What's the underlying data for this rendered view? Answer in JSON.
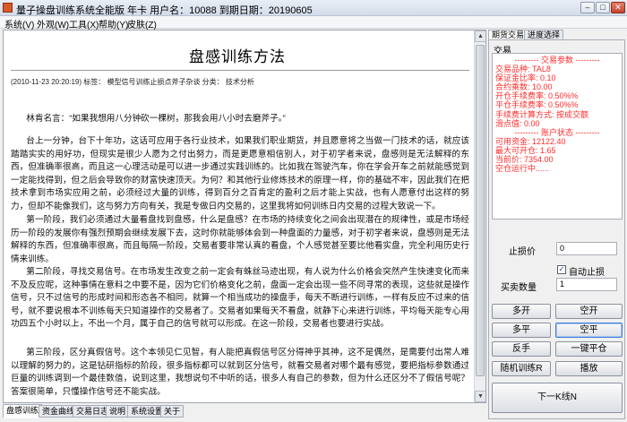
{
  "window": {
    "title": "量子操盘训练系统全能版 年卡 用户名：10088 到期日期：20190605"
  },
  "menu": [
    "系统(V)",
    "外观(W)",
    "工具(X)",
    "帮助(Y)",
    "皮肤(Z)"
  ],
  "doc": {
    "title": "盘感训练方法",
    "meta": "(2010-11-23 20:20:19) 标签：   模型信号训练止损点斧子杂谈  分类：   技术分析",
    "quote": "林肯名言：“如果我想用八分钟砍一棵树，那我会用八小时去磨斧子。”",
    "paragraphs": [
      "台上一分钟，台下十年功，这话可应用于各行业技术，如果我们职业期货，并且愿意将之当做一门技术的话，就应该踏踏实实的用好功，但现实是很少人愿为之付出努力，而是更愿意相信别人，对于初学者来说，盘感则是无法解释的东西，但准确率很高，而且这一心理活动是可以进一步通过实践训练的。比如我在驾驶汽车，你在学会开车之前就能感觉到一定能找得到，但之后会导致你的财富快速顶天。为何？和其他行业修炼技术的原理一样，你的基础不牢，因此我们在把技术拿到市场实应用之前，必须经过大量的训练，得到百分之百肯定的盈利之后才能上实战，也有人愿意付出这样的努力，但却不能像我们，这与努力方向有关，我是专做日内交易的，这里我将如何训练日内交易的过程大致说一下。",
      "第一阶段，我们必须通过大量看盘找到盘感，什么是盘感？在市场的持续变化之间会出现潜在的规律性，或是市场经历一阶段的发展你有强烈预期会继续发展下去，这时你就能够体会到一种盘面的力量感，对于初学者来说，盘感则是无法解释的东西，但准确率很高，而且每隔一阶段，交易者要非常认真的看盘，个人感觉甚至要比他看实盘，完全利用历史行情来训练。",
      "第二阶段，寻找交易信号。在市场发生改变之前一定会有蛛丝马迹出现，有人说为什么价格会突然产生快速变化而来不及反应呢，这种事情在意料之中要不是，因为它们价格变化之前，盘面一定会出现一些不同寻常的表现，这些就是操作信号，只不过信号的形成时间和形态各不相同，就算一个相当成功的操盘手，每天不断进行训练，一样有反应不过来的信号，就不要说根本不训练每天只知道操作的交易者了。交易者如果每天不看盘，就静下心来进行训练，平均每天能专心用功四五个小时以上，不出一个月，属于自己的信号就可以形成。在这一阶段，交易者也要进行实战。",
      "第三阶段，区分真假信号。这个本领见仁见智，有人能把真假信号区分得神乎其神，这不是偶然，是需要付出常人难以理解的努力的，这是钻研指标的阶段，很多指标都可以就到区分信号，就看交易者对哪个最有感觉，要把指标参数通过巨量的训练调到一个最佳数值，说到这里，我想说句不中听的话，很多人有自己的参数，但为什么还区分不了假信号呢？答案很简单，只懂操作信号还不能实战。"
    ]
  },
  "bottom_tabs": [
    "盘感训练",
    "资金曲线",
    "交易日志",
    "说明",
    "系统设置",
    "关于"
  ],
  "right_tabs": [
    "期货交易",
    "进度选择"
  ],
  "trade": {
    "group_label": "交易",
    "lines": [
      "--------- 交易参数 ---------",
      "交易品种: TAL8",
      "保证金比率: 0.10",
      "合约乘数: 10.00",
      "开仓手续费率: 0.50%%",
      "平仓手续费率: 0.50%%",
      "手续费计算方式: 按成交额",
      "滑点值: 0.00",
      "--------- 账户状态 ---------",
      "可用资金: 12122.40",
      "最大可开仓: 1.65",
      "当前价: 7354.00",
      "空仓运行中......"
    ],
    "stop_label": "止损价",
    "stop_value": "0",
    "auto_stop_label": "自动止损",
    "auto_stop_checked": "✓",
    "qty_label": "买卖数量",
    "qty_value": "1",
    "buttons": {
      "open_long": "多开",
      "open_short": "空开",
      "close_long": "多平",
      "close_short": "空平",
      "reverse": "反手",
      "one_key_close": "一键平仓",
      "random_train": "随机训练R",
      "play": "播放",
      "next_k": "下一K线N"
    }
  },
  "colors": {
    "info_text": "#ff2d2d",
    "title_bar": "#d3dcea"
  }
}
